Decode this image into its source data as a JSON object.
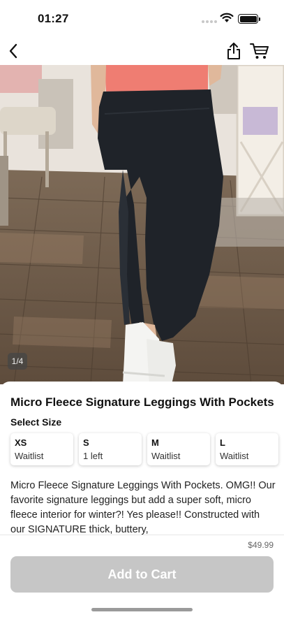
{
  "status_bar": {
    "time": "01:27",
    "icons": [
      "signal-dots-icon",
      "wifi-icon",
      "battery-icon"
    ]
  },
  "nav": {
    "icons": [
      "chevron-left-icon",
      "share-icon",
      "cart-icon"
    ]
  },
  "gallery": {
    "counter": "1/4",
    "image_description_icon": "photo-leggings"
  },
  "product": {
    "title": "Micro Fleece Signature Leggings With Pockets",
    "select_size_label": "Select Size",
    "sizes": [
      {
        "name": "XS",
        "status": "Waitlist"
      },
      {
        "name": "S",
        "status": "1 left"
      },
      {
        "name": "M",
        "status": "Waitlist"
      },
      {
        "name": "L",
        "status": "Waitlist"
      }
    ],
    "description": "Micro Fleece Signature Leggings With Pockets. OMG!! Our favorite signature leggings but add a super soft, micro fleece interior for winter?! Yes please!! Constructed with our SIGNATURE thick, buttery,",
    "price": "$49.99",
    "add_to_cart_label": "Add to Cart"
  },
  "colors": {
    "button_disabled": "#c6c6c6",
    "top_shirt": "#ef7d72",
    "leggings": "#1f2329"
  }
}
